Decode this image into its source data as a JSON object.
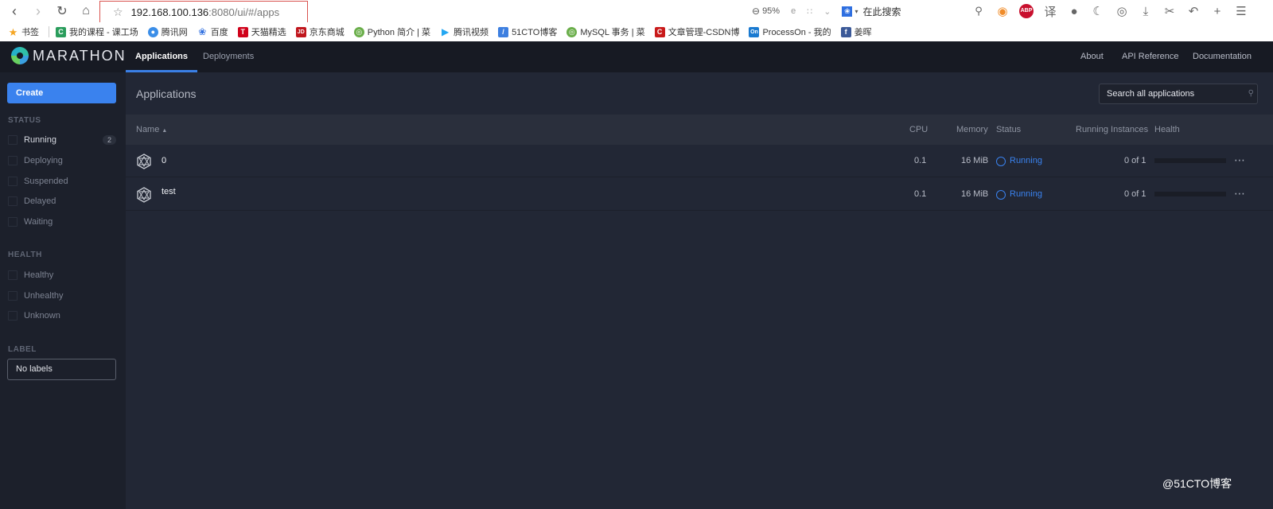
{
  "browser": {
    "url_host": "192.168.100.136",
    "url_path": ":8080/ui/#/apps",
    "zoom_level": "95%",
    "search_placeholder": "在此搜索",
    "bookmarks": [
      {
        "label": "书签",
        "color": "#f5a623",
        "glyph": "★"
      },
      {
        "label": "我的课程 - 课工场",
        "color": "#2a9d5c",
        "glyph": "C"
      },
      {
        "label": "腾讯网",
        "color": "#3b8ee8",
        "glyph": "◉"
      },
      {
        "label": "百度",
        "color": "#2f6fe0",
        "glyph": "✿"
      },
      {
        "label": "天猫精选",
        "color": "#d0021b",
        "glyph": "T"
      },
      {
        "label": "京东商城",
        "color": "#c0161d",
        "glyph": "JD"
      },
      {
        "label": "Python 简介 | 菜",
        "color": "#6aae4a",
        "glyph": "◎"
      },
      {
        "label": "腾讯视频",
        "color": "#23a7f2",
        "glyph": "▶"
      },
      {
        "label": "51CTO博客",
        "color": "#3d7fe0",
        "glyph": "/"
      },
      {
        "label": "MySQL 事务 | 菜",
        "color": "#6aae4a",
        "glyph": "◎"
      },
      {
        "label": "文章管理-CSDN博",
        "color": "#c91b1b",
        "glyph": "C"
      },
      {
        "label": "ProcessOn - 我的",
        "color": "#1a7ad0",
        "glyph": "On"
      },
      {
        "label": "姜晖",
        "color": "#3b5998",
        "glyph": "f"
      }
    ]
  },
  "app": {
    "brand": "MARATHON",
    "tabs": [
      {
        "label": "Applications",
        "active": true
      },
      {
        "label": "Deployments",
        "active": false
      }
    ],
    "links": [
      "About",
      "API Reference",
      "Documentation"
    ],
    "create_label": "Create",
    "sidebar": {
      "status_heading": "STATUS",
      "status_items": [
        {
          "label": "Running",
          "count": "2"
        },
        {
          "label": "Deploying"
        },
        {
          "label": "Suspended"
        },
        {
          "label": "Delayed"
        },
        {
          "label": "Waiting"
        }
      ],
      "health_heading": "HEALTH",
      "health_items": [
        {
          "label": "Healthy"
        },
        {
          "label": "Unhealthy"
        },
        {
          "label": "Unknown"
        }
      ],
      "label_heading": "LABEL",
      "label_select": "No labels"
    },
    "page_title": "Applications",
    "search_placeholder": "Search all applications",
    "table": {
      "columns": [
        "Name",
        "CPU",
        "Memory",
        "Status",
        "Running Instances",
        "Health"
      ],
      "rows": [
        {
          "name": "0",
          "cpu": "0.1",
          "memory": "16 MiB",
          "status": "Running",
          "instances": "0 of 1"
        },
        {
          "name": "test",
          "cpu": "0.1",
          "memory": "16 MiB",
          "status": "Running",
          "instances": "0 of 1"
        }
      ]
    },
    "accent_color": "#3a82ee"
  },
  "watermark": "@51CTO博客"
}
